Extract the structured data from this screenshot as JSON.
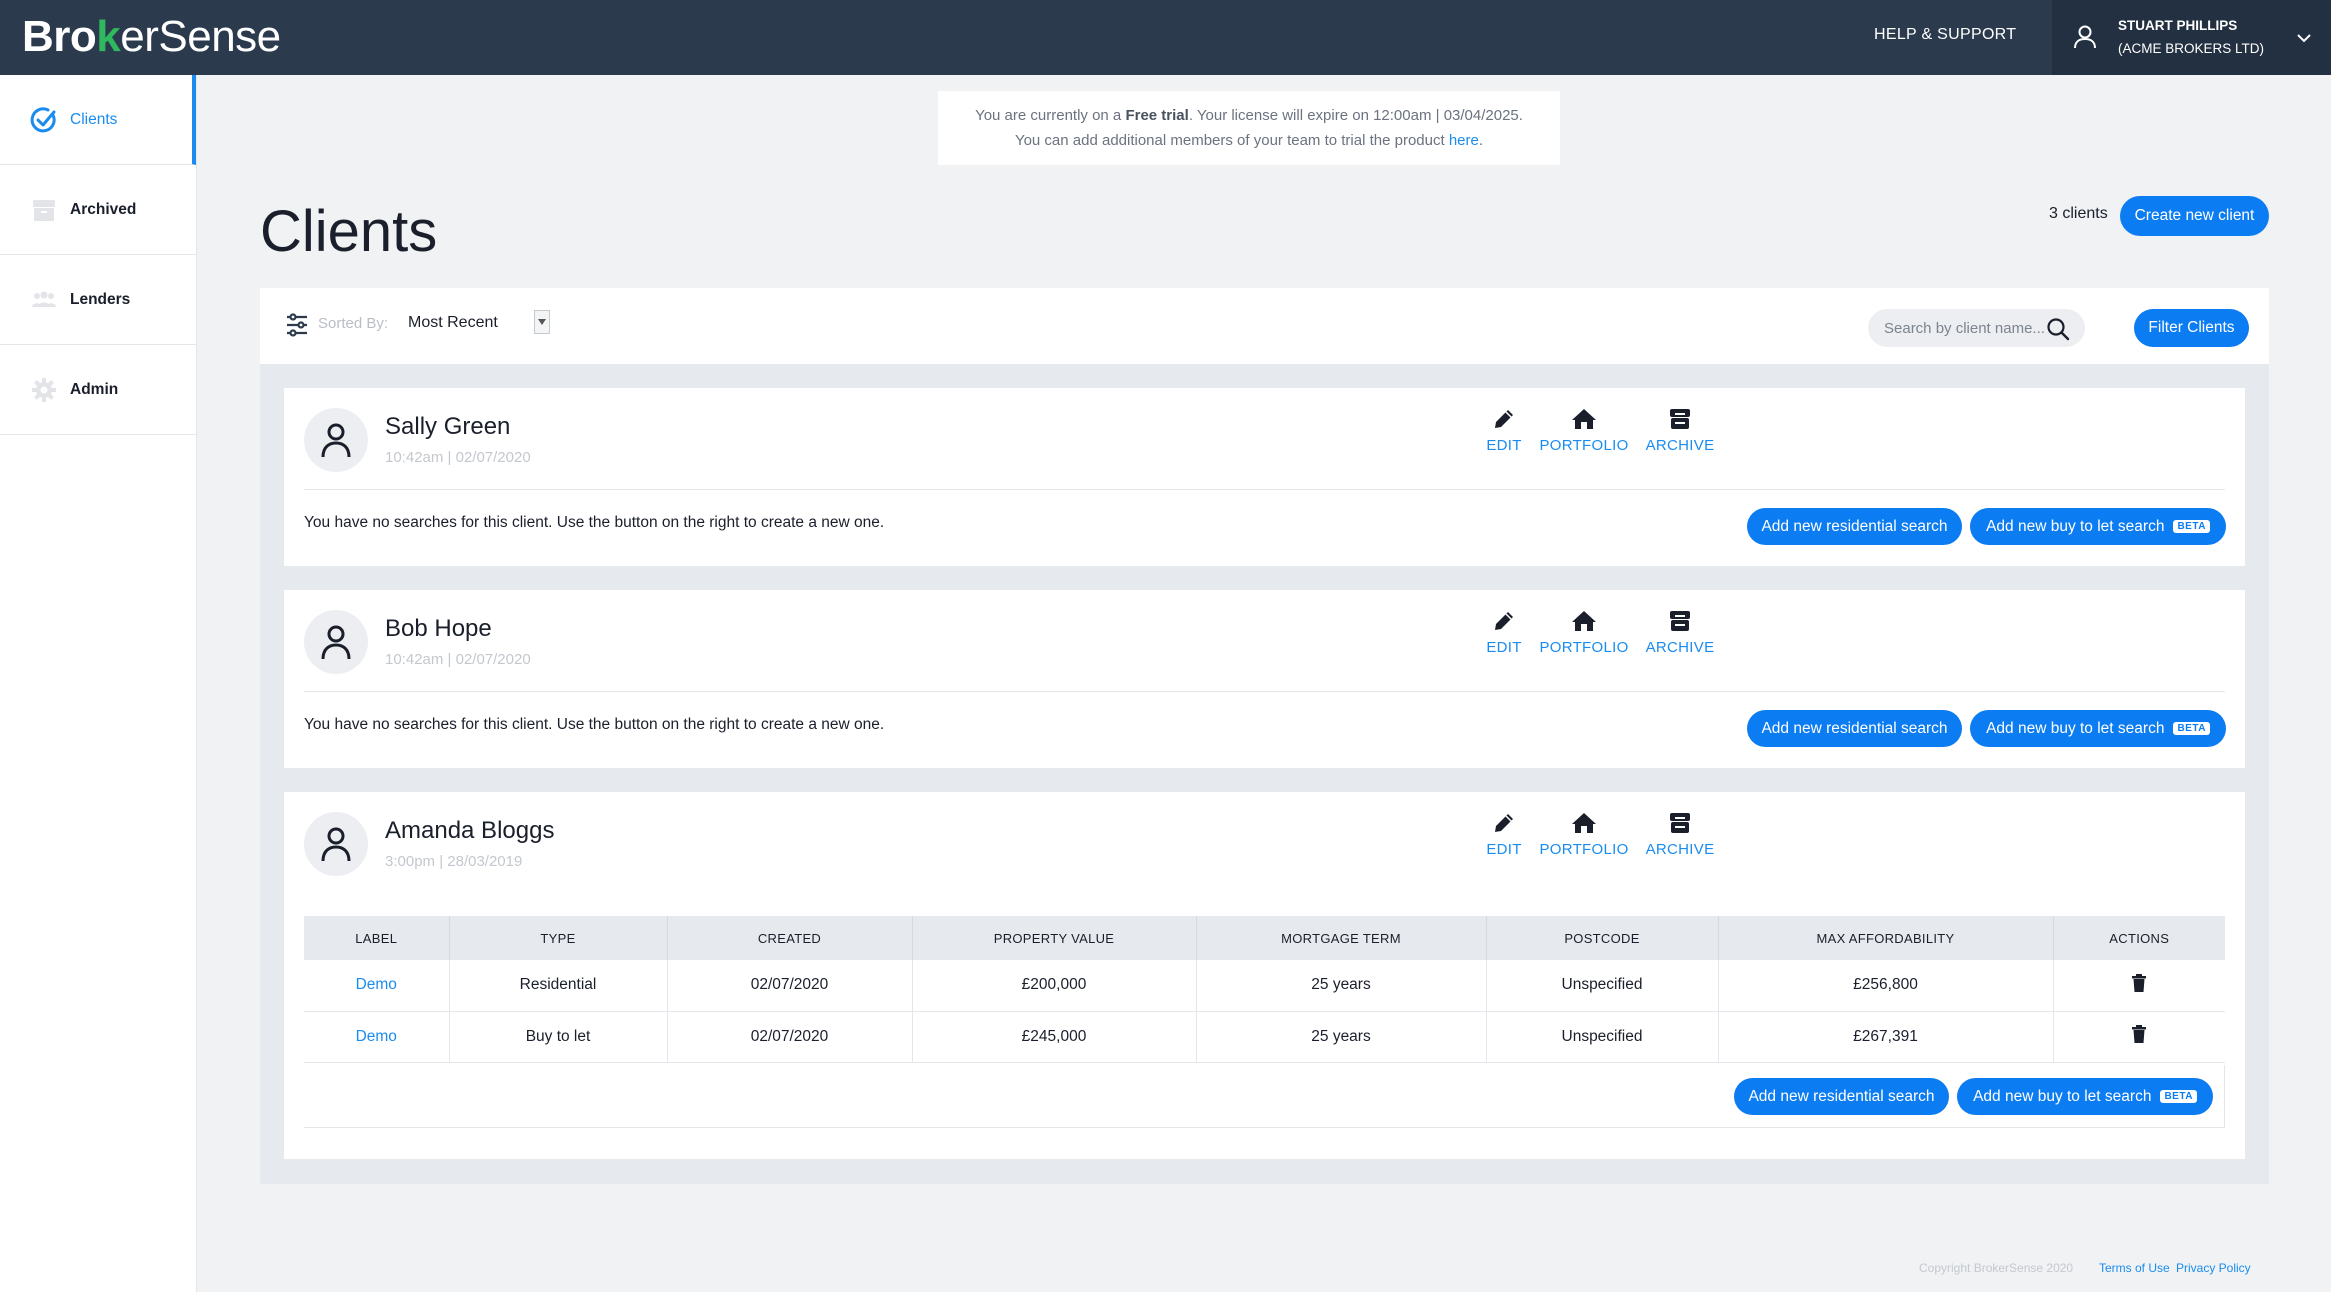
{
  "brand": {
    "logo_part1": "Bro",
    "logo_part2": "k",
    "logo_part3": "erSense"
  },
  "header": {
    "help_label": "HELP & SUPPORT",
    "user_name": "STUART PHILLIPS",
    "user_org": "(ACME BROKERS LTD)"
  },
  "sidebar": {
    "items": [
      {
        "label": "Clients",
        "icon": "check-circle-icon",
        "active": true
      },
      {
        "label": "Archived",
        "icon": "archive-box-icon"
      },
      {
        "label": "Lenders",
        "icon": "people-group-icon"
      },
      {
        "label": "Admin",
        "icon": "gear-icon"
      }
    ]
  },
  "notice": {
    "line1_pre": "You are currently on a ",
    "line1_bold": "Free trial",
    "line1_post": ". Your license will expire on 12:00am | 03/04/2025.",
    "line2_pre": "You can add additional members of your team to trial the product ",
    "line2_link": "here",
    "line2_post": "."
  },
  "page": {
    "title": "Clients",
    "client_count": "3 clients",
    "create_label": "Create new client"
  },
  "toolbar": {
    "sorted_by_label": "Sorted By:",
    "sort_value": "Most Recent",
    "search_placeholder": "Search by client name...",
    "filter_label": "Filter Clients"
  },
  "actions": {
    "edit": "EDIT",
    "portfolio": "PORTFOLIO",
    "archive": "ARCHIVE"
  },
  "buttons": {
    "residential": "Add new residential search",
    "buy_to_let": "Add new buy to let search",
    "beta": "BETA"
  },
  "clients": [
    {
      "name": "Sally Green",
      "time": "10:42am | 02/07/2020",
      "message": "You have no searches for this client. Use the button on the right to create a new one."
    },
    {
      "name": "Bob Hope",
      "time": "10:42am | 02/07/2020",
      "message": "You have no searches for this client. Use the button on the right to create a new one."
    },
    {
      "name": "Amanda Bloggs",
      "time": "3:00pm | 28/03/2019"
    }
  ],
  "table": {
    "headers": [
      "LABEL",
      "TYPE",
      "CREATED",
      "PROPERTY VALUE",
      "MORTGAGE TERM",
      "POSTCODE",
      "MAX AFFORDABILITY",
      "ACTIONS"
    ],
    "rows": [
      {
        "label": "Demo",
        "type": "Residential",
        "created": "02/07/2020",
        "value": "£200,000",
        "term": "25 years",
        "postcode": "Unspecified",
        "max": "£256,800",
        "action_icon": "trash-icon"
      },
      {
        "label": "Demo",
        "type": "Buy to let",
        "created": "02/07/2020",
        "value": "£245,000",
        "term": "25 years",
        "postcode": "Unspecified",
        "max": "£267,391",
        "action_icon": "trash-icon"
      }
    ]
  },
  "footer": {
    "copyright": "Copyright BrokerSense 2020",
    "terms": "Terms of Use",
    "privacy": "Privacy Policy"
  },
  "colors": {
    "accent": "#0b7cf2",
    "header_bg": "#2b3a4d",
    "brand_green": "#2fb85d"
  }
}
